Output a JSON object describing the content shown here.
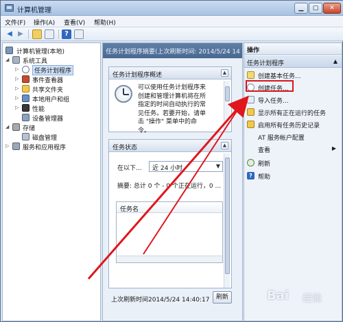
{
  "window": {
    "title": "计算机管理"
  },
  "menu": [
    "文件(F)",
    "操作(A)",
    "查看(V)",
    "帮助(H)"
  ],
  "toolbar": {
    "icons": [
      "back-icon",
      "forward-icon",
      "up-folder-icon",
      "show-tree-icon",
      "help-icon",
      "console-icon"
    ]
  },
  "tree": {
    "root": "计算机管理(本地)",
    "system_tools": "系统工具",
    "task_scheduler": "任务计划程序",
    "event_viewer": "事件查看器",
    "shared_folders": "共享文件夹",
    "local_users": "本地用户和组",
    "performance": "性能",
    "device_manager": "设备管理器",
    "storage": "存储",
    "disk_management": "磁盘管理",
    "services": "服务和应用程序"
  },
  "middle": {
    "header": "任务计划程序摘要(上次刷新时间: 2014/5/24 14",
    "overview_title": "任务计划程序概述",
    "overview_lines": [
      "可以使用任务计划程序来",
      "创建和管理计算机将在所",
      "指定的时间自动执行的常",
      "见任务。若要开始，请单",
      "击 \"操作\" 菜单中的命",
      "令。"
    ],
    "status_title": "任务状态",
    "range_label": "在以下...",
    "range_value": "近 24 小时",
    "summary": "摘要: 总计 0 个 - 0 个正在运行，0 ...",
    "task_name_column": "任务名",
    "last_refresh": "上次刷新时间2014/5/24 14:40:17",
    "refresh_button": "刷新"
  },
  "actions": {
    "header": "操作",
    "sub_header": "任务计划程序",
    "items": [
      {
        "label": "创建基本任务...",
        "icon": "basic-task-icon"
      },
      {
        "label": "创建任务...",
        "icon": "create-task-icon"
      },
      {
        "label": "导入任务...",
        "icon": "import-icon"
      },
      {
        "label": "显示所有正在运行的任务",
        "icon": "running-tasks-icon"
      },
      {
        "label": "启用所有任务历史记录",
        "icon": "history-icon"
      },
      {
        "label": "AT 服务帐户配置",
        "icon": ""
      },
      {
        "label": "查看",
        "icon": ""
      },
      {
        "label": "刷新",
        "icon": "refresh-icon"
      },
      {
        "label": "帮助",
        "icon": "help-icon"
      }
    ]
  },
  "watermark": {
    "brand": "Bai",
    "sub": "经验"
  },
  "colors": {
    "highlight": "#d8161c",
    "arrow": "#e0161c"
  }
}
